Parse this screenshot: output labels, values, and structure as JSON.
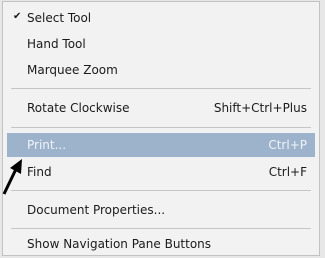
{
  "menu": {
    "items": [
      {
        "label": "Select Tool",
        "shortcut": "",
        "checked": true
      },
      {
        "label": "Hand Tool",
        "shortcut": "",
        "checked": false
      },
      {
        "label": "Marquee Zoom",
        "shortcut": "",
        "checked": false
      },
      {
        "label": "Rotate Clockwise",
        "shortcut": "Shift+Ctrl+Plus",
        "checked": false
      },
      {
        "label": "Print...",
        "shortcut": "Ctrl+P",
        "checked": false,
        "highlighted": true
      },
      {
        "label": "Find",
        "shortcut": "Ctrl+F",
        "checked": false
      },
      {
        "label": "Document Properties...",
        "shortcut": "",
        "checked": false
      },
      {
        "label": "Show Navigation Pane Buttons",
        "shortcut": "",
        "checked": false
      }
    ],
    "check_glyph": "✔",
    "highlight_color": "#9db3cc"
  },
  "pointer": {
    "icon": "arrow-pointer-icon"
  }
}
